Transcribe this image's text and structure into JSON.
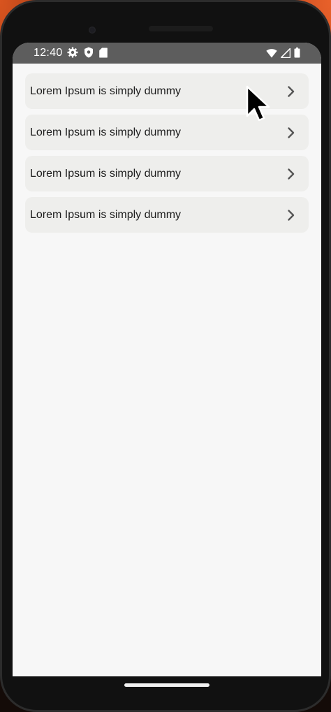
{
  "status_bar": {
    "time": "12:40",
    "left_icons": [
      "settings-icon",
      "shield-icon",
      "sd-card-icon"
    ],
    "right_icons": [
      "wifi-icon",
      "signal-icon",
      "battery-icon"
    ]
  },
  "list": {
    "items": [
      {
        "label": "Lorem Ipsum is simply dummy",
        "icon": "chevron-right-icon"
      },
      {
        "label": "Lorem Ipsum is simply dummy",
        "icon": "chevron-right-icon"
      },
      {
        "label": "Lorem Ipsum is simply dummy",
        "icon": "chevron-right-icon"
      },
      {
        "label": "Lorem Ipsum is simply dummy",
        "icon": "chevron-right-icon"
      }
    ]
  },
  "colors": {
    "status_bar_bg": "#5d5d5d",
    "screen_bg": "#f7f7f7",
    "item_bg": "#eeeeec",
    "text": "#1c1c1c",
    "chevron": "#555555"
  }
}
